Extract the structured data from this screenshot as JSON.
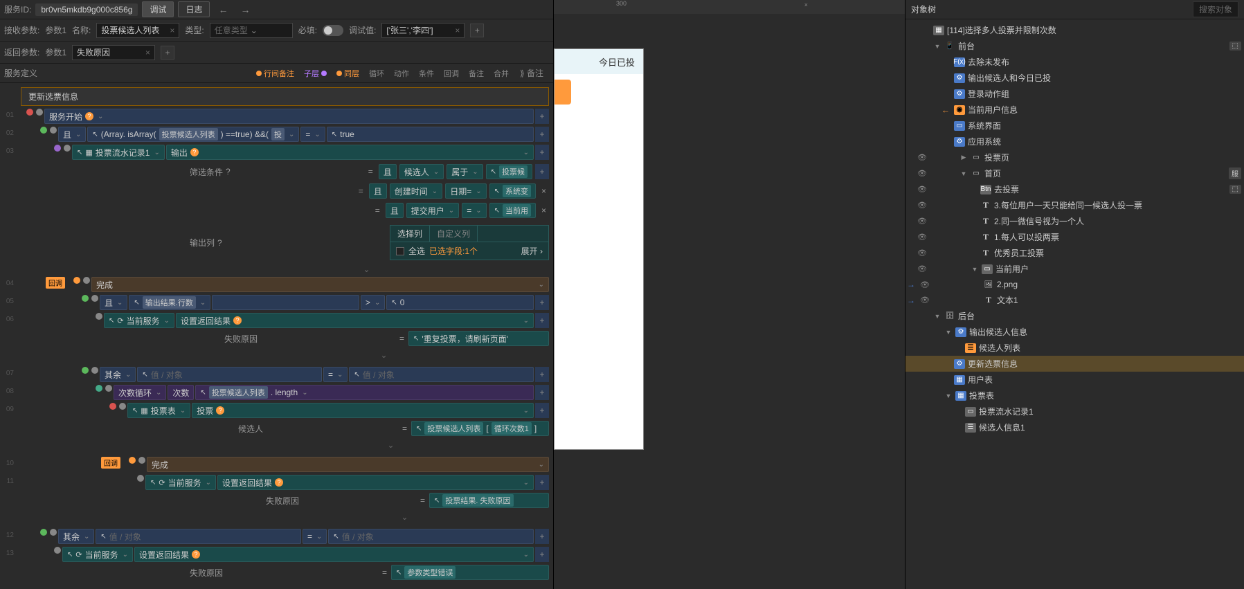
{
  "topbar": {
    "service_id_label": "服务ID:",
    "service_id": "br0vn5mkdb9g000c856g",
    "debug_btn": "调试",
    "log_btn": "日志"
  },
  "accept_params": {
    "label": "接收参数:",
    "param_name": "参数1",
    "name_label": "名称:",
    "name_value": "投票候选人列表",
    "type_label": "类型:",
    "type_value": "任意类型",
    "required_label": "必填:",
    "debug_val_label": "调试值:",
    "debug_val": "['张三','李四']"
  },
  "return_params": {
    "label": "返回参数:",
    "param_name": "参数1",
    "value": "失败原因"
  },
  "service_def": {
    "title": "服务定义",
    "tabs": {
      "inline_remark": "行间备注",
      "sublayer": "子层",
      "same_layer": "同层",
      "loop": "循环",
      "action": "动作",
      "condition": "条件",
      "callback": "回调",
      "remark": "备注",
      "merge": "合并"
    },
    "remark_btn": "备注"
  },
  "flow": {
    "title": "更新选票信息",
    "rows": {
      "r01": {
        "num": "01",
        "service_start": "服务开始"
      },
      "r02": {
        "num": "02",
        "and": "且",
        "array_check": "(Array. isArray(",
        "param": "投票候选人列表",
        "eq_true": ") ==true) &&(",
        "param2": "投",
        "eq": "=",
        "true": "true"
      },
      "r03": {
        "num": "03",
        "table": "投票流水记录1",
        "output": "输出"
      },
      "filter": {
        "label": "筛选条件",
        "r1": {
          "and": "且",
          "field": "候选人",
          "op": "属于",
          "val": "投票候"
        },
        "r2": {
          "and": "且",
          "field": "创建时间",
          "op": "日期=",
          "val": "系统变"
        },
        "r3": {
          "and": "且",
          "field": "提交用户",
          "op": "=",
          "val": "当前用"
        }
      },
      "output_col": {
        "label": "输出列",
        "tab1": "选择列",
        "tab2": "自定义列",
        "select_all": "全选",
        "selected": "已选字段:1个",
        "expand": "展开"
      },
      "r04": {
        "num": "04",
        "callback": "回调",
        "complete": "完成"
      },
      "r05": {
        "num": "05",
        "and": "且",
        "field": "输出结果.行数",
        "op": ">",
        "val": "0"
      },
      "r06": {
        "num": "06",
        "service": "当前服务",
        "set_return": "设置返回结果"
      },
      "r06b": {
        "fail_reason": "失败原因",
        "eq": "=",
        "msg": "'重复投票，请刷新页面'"
      },
      "r07": {
        "num": "07",
        "else": "其余",
        "placeholder": "值 / 对象",
        "eq": "=",
        "placeholder2": "值 / 对象"
      },
      "r08": {
        "num": "08",
        "loop": "次数循环",
        "times": "次数",
        "expr": "投票候选人列表",
        "len": ". length"
      },
      "r09": {
        "num": "09",
        "table": "投票表",
        "vote": "投票"
      },
      "r09b": {
        "candidate": "候选人",
        "eq": "=",
        "expr": "投票候选人列表",
        "idx": "循环次数1"
      },
      "r10": {
        "num": "10",
        "callback": "回调",
        "complete": "完成"
      },
      "r11": {
        "num": "11",
        "service": "当前服务",
        "set_return": "设置返回结果"
      },
      "r11b": {
        "fail_reason": "失败原因",
        "eq": "=",
        "expr": "投票结果. 失败原因"
      },
      "r12": {
        "num": "12",
        "else": "其余",
        "placeholder": "值 / 对象",
        "eq": "=",
        "placeholder2": "值 / 对象"
      },
      "r13": {
        "num": "13",
        "service": "当前服务",
        "set_return": "设置返回结果"
      },
      "r13b": {
        "fail_reason": "失败原因",
        "eq": "=",
        "msg": "参数类型错误"
      }
    }
  },
  "preview": {
    "ruler_300": "300",
    "today_voted": "今日已投"
  },
  "tree": {
    "header": "对象树",
    "search_placeholder": "搜索对象",
    "items": {
      "root": "[114]选择多人投票并限制次数",
      "frontend": "前台",
      "remove_unpub": "去除未发布",
      "output_cand": "输出候选人和今日已投",
      "login_group": "登录动作组",
      "current_user": "当前用户信息",
      "sys_ui": "系统界面",
      "app_sys": "应用系统",
      "vote_page": "投票页",
      "home": "首页",
      "go_vote": "去投票",
      "rule3": "3.每位用户一天只能给同一候选人投一票",
      "rule2": "2.同一微信号视为一个人",
      "rule1": "1.每人可以投两票",
      "excellent": "优秀员工投票",
      "current_user2": "当前用户",
      "img2": "2.png",
      "text1": "文本1",
      "backend": "后台",
      "output_cand_info": "输出候选人信息",
      "cand_list": "候选人列表",
      "update_vote": "更新选票信息",
      "user_table": "用户表",
      "vote_table": "投票表",
      "vote_record1": "投票流水记录1",
      "cand_info1": "候选人信息1"
    }
  }
}
